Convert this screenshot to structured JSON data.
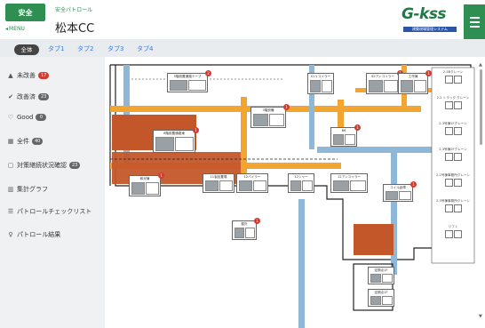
{
  "header": {
    "logo": "安全",
    "menu": "MENU",
    "subtitle": "安全パトロール",
    "title": "松本CC",
    "brand": "G-kss",
    "brand_sub": "建築現場管理システム"
  },
  "tabs": [
    "全体",
    "タブ1",
    "タブ2",
    "タブ3",
    "タブ4"
  ],
  "sidebar": [
    {
      "label": "未改善",
      "badge": "17",
      "badge_style": "red",
      "icon": "warning-icon"
    },
    {
      "label": "改善済",
      "badge": "23",
      "badge_style": "gray",
      "icon": "check-circle-icon"
    },
    {
      "label": "Good",
      "badge": "0",
      "badge_style": "gray",
      "icon": "thumbs-up-icon"
    },
    {
      "label": "全件",
      "badge": "40",
      "badge_style": "gray",
      "icon": "grid-icon"
    },
    {
      "label": "対策継続状況確認",
      "badge": "23",
      "badge_style": "gray",
      "icon": "clipboard-icon"
    },
    {
      "label": "集計グラフ",
      "badge": "",
      "badge_style": "none",
      "icon": "bar-chart-icon"
    },
    {
      "label": "パトロールチェックリスト",
      "badge": "",
      "badge_style": "none",
      "icon": "list-icon"
    },
    {
      "label": "パトロール結果",
      "badge": "",
      "badge_style": "none",
      "icon": "lightbulb-icon"
    }
  ],
  "map_cards": [
    {
      "label": "5階設置通路テーブ",
      "badge": "2"
    },
    {
      "label": "3階設備",
      "badge": "1"
    },
    {
      "label": "S1リコイラー",
      "badge": ""
    },
    {
      "label": "S2アンコイラー",
      "badge": "1"
    },
    {
      "label": "工作棟",
      "badge": "1"
    },
    {
      "label": "6階設置通路東",
      "badge": "1"
    },
    {
      "label": "B6",
      "badge": "1"
    },
    {
      "label": "和光棟",
      "badge": "1"
    },
    {
      "label": "11製品置場",
      "badge": ""
    },
    {
      "label": "12バイラー",
      "badge": ""
    },
    {
      "label": "12シャー",
      "badge": ""
    },
    {
      "label": "12アンコイラー",
      "badge": ""
    },
    {
      "label": "コイル倉庫",
      "badge": "1"
    },
    {
      "label": "屋外",
      "badge": "1"
    },
    {
      "label": "定期点1F",
      "badge": ""
    },
    {
      "label": "定期点1F",
      "badge": ""
    }
  ],
  "crane_panel": [
    "2-5Bクレーン",
    "2-2 トラック クレーン",
    "2-3号棟1Fクレーン",
    "2-3号棟2Fクレーン",
    "2-2号棟事務所クレーン",
    "2-3号棟事務所クレーン",
    "リフト"
  ],
  "colors": {
    "accent": "#2f8f52",
    "walkway": "#f2a531",
    "water": "#8fb8d8",
    "zone": "#c4572a",
    "badge": "#d23b30"
  }
}
